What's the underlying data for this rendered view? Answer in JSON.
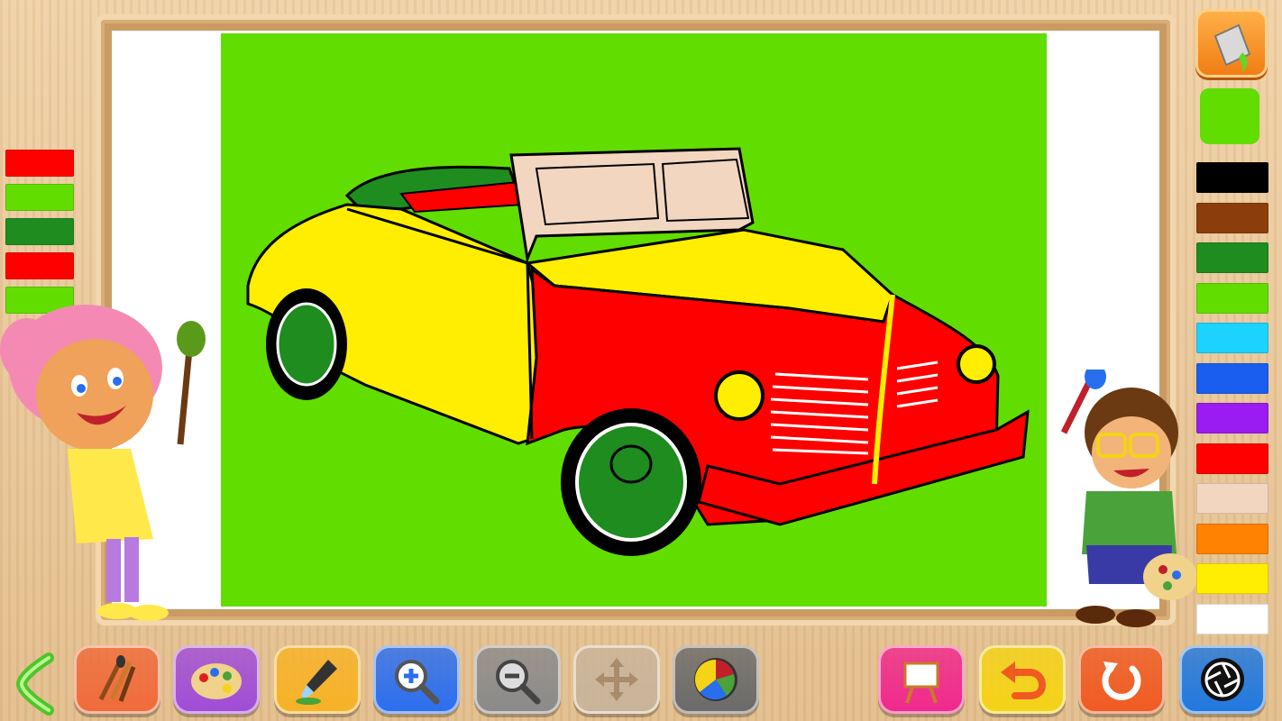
{
  "app": {
    "scene": "coloring-book",
    "picture": "classic-convertible-car"
  },
  "canvas": {
    "background_color": "#62dd00"
  },
  "used_colors": [
    "#ff0000",
    "#62dd00",
    "#1e8c1e",
    "#ff0000",
    "#62dd00"
  ],
  "selected_color": "#62dd00",
  "palette": [
    {
      "name": "black",
      "hex": "#000000"
    },
    {
      "name": "brown",
      "hex": "#8b3e0b"
    },
    {
      "name": "dark-green",
      "hex": "#1e8c1e"
    },
    {
      "name": "light-green",
      "hex": "#62dd00"
    },
    {
      "name": "sky-blue",
      "hex": "#1cd3ff"
    },
    {
      "name": "blue",
      "hex": "#1a5ef0"
    },
    {
      "name": "purple",
      "hex": "#9a1cf0"
    },
    {
      "name": "red",
      "hex": "#ff0000"
    },
    {
      "name": "skin",
      "hex": "#f2d6c0"
    },
    {
      "name": "orange",
      "hex": "#ff8200"
    },
    {
      "name": "yellow",
      "hex": "#ffee00"
    },
    {
      "name": "white",
      "hex": "#ffffff"
    }
  ],
  "toolbar": [
    {
      "id": "brushes",
      "icon": "paintbrushes-icon",
      "color": "#f06a3a"
    },
    {
      "id": "palette",
      "icon": "palette-icon",
      "color": "#a04cd8"
    },
    {
      "id": "dropper",
      "icon": "eyedropper-icon",
      "color": "#f7b226"
    },
    {
      "id": "zoom-in",
      "icon": "zoom-in-icon",
      "color": "#2a6ef0"
    },
    {
      "id": "zoom-out",
      "icon": "zoom-out-icon",
      "color": "#8a8a8a"
    },
    {
      "id": "move",
      "icon": "move-icon",
      "color": "#c9b49a"
    },
    {
      "id": "color-wheel",
      "icon": "color-wheel-icon",
      "color": "#6a6a6a"
    },
    {
      "id": "new-canvas",
      "icon": "easel-icon",
      "color": "#f0288c"
    },
    {
      "id": "undo",
      "icon": "undo-icon",
      "color": "#f5d316"
    },
    {
      "id": "reset",
      "icon": "reset-icon",
      "color": "#f05a22"
    },
    {
      "id": "camera",
      "icon": "camera-shutter-icon",
      "color": "#1f78e0"
    }
  ]
}
